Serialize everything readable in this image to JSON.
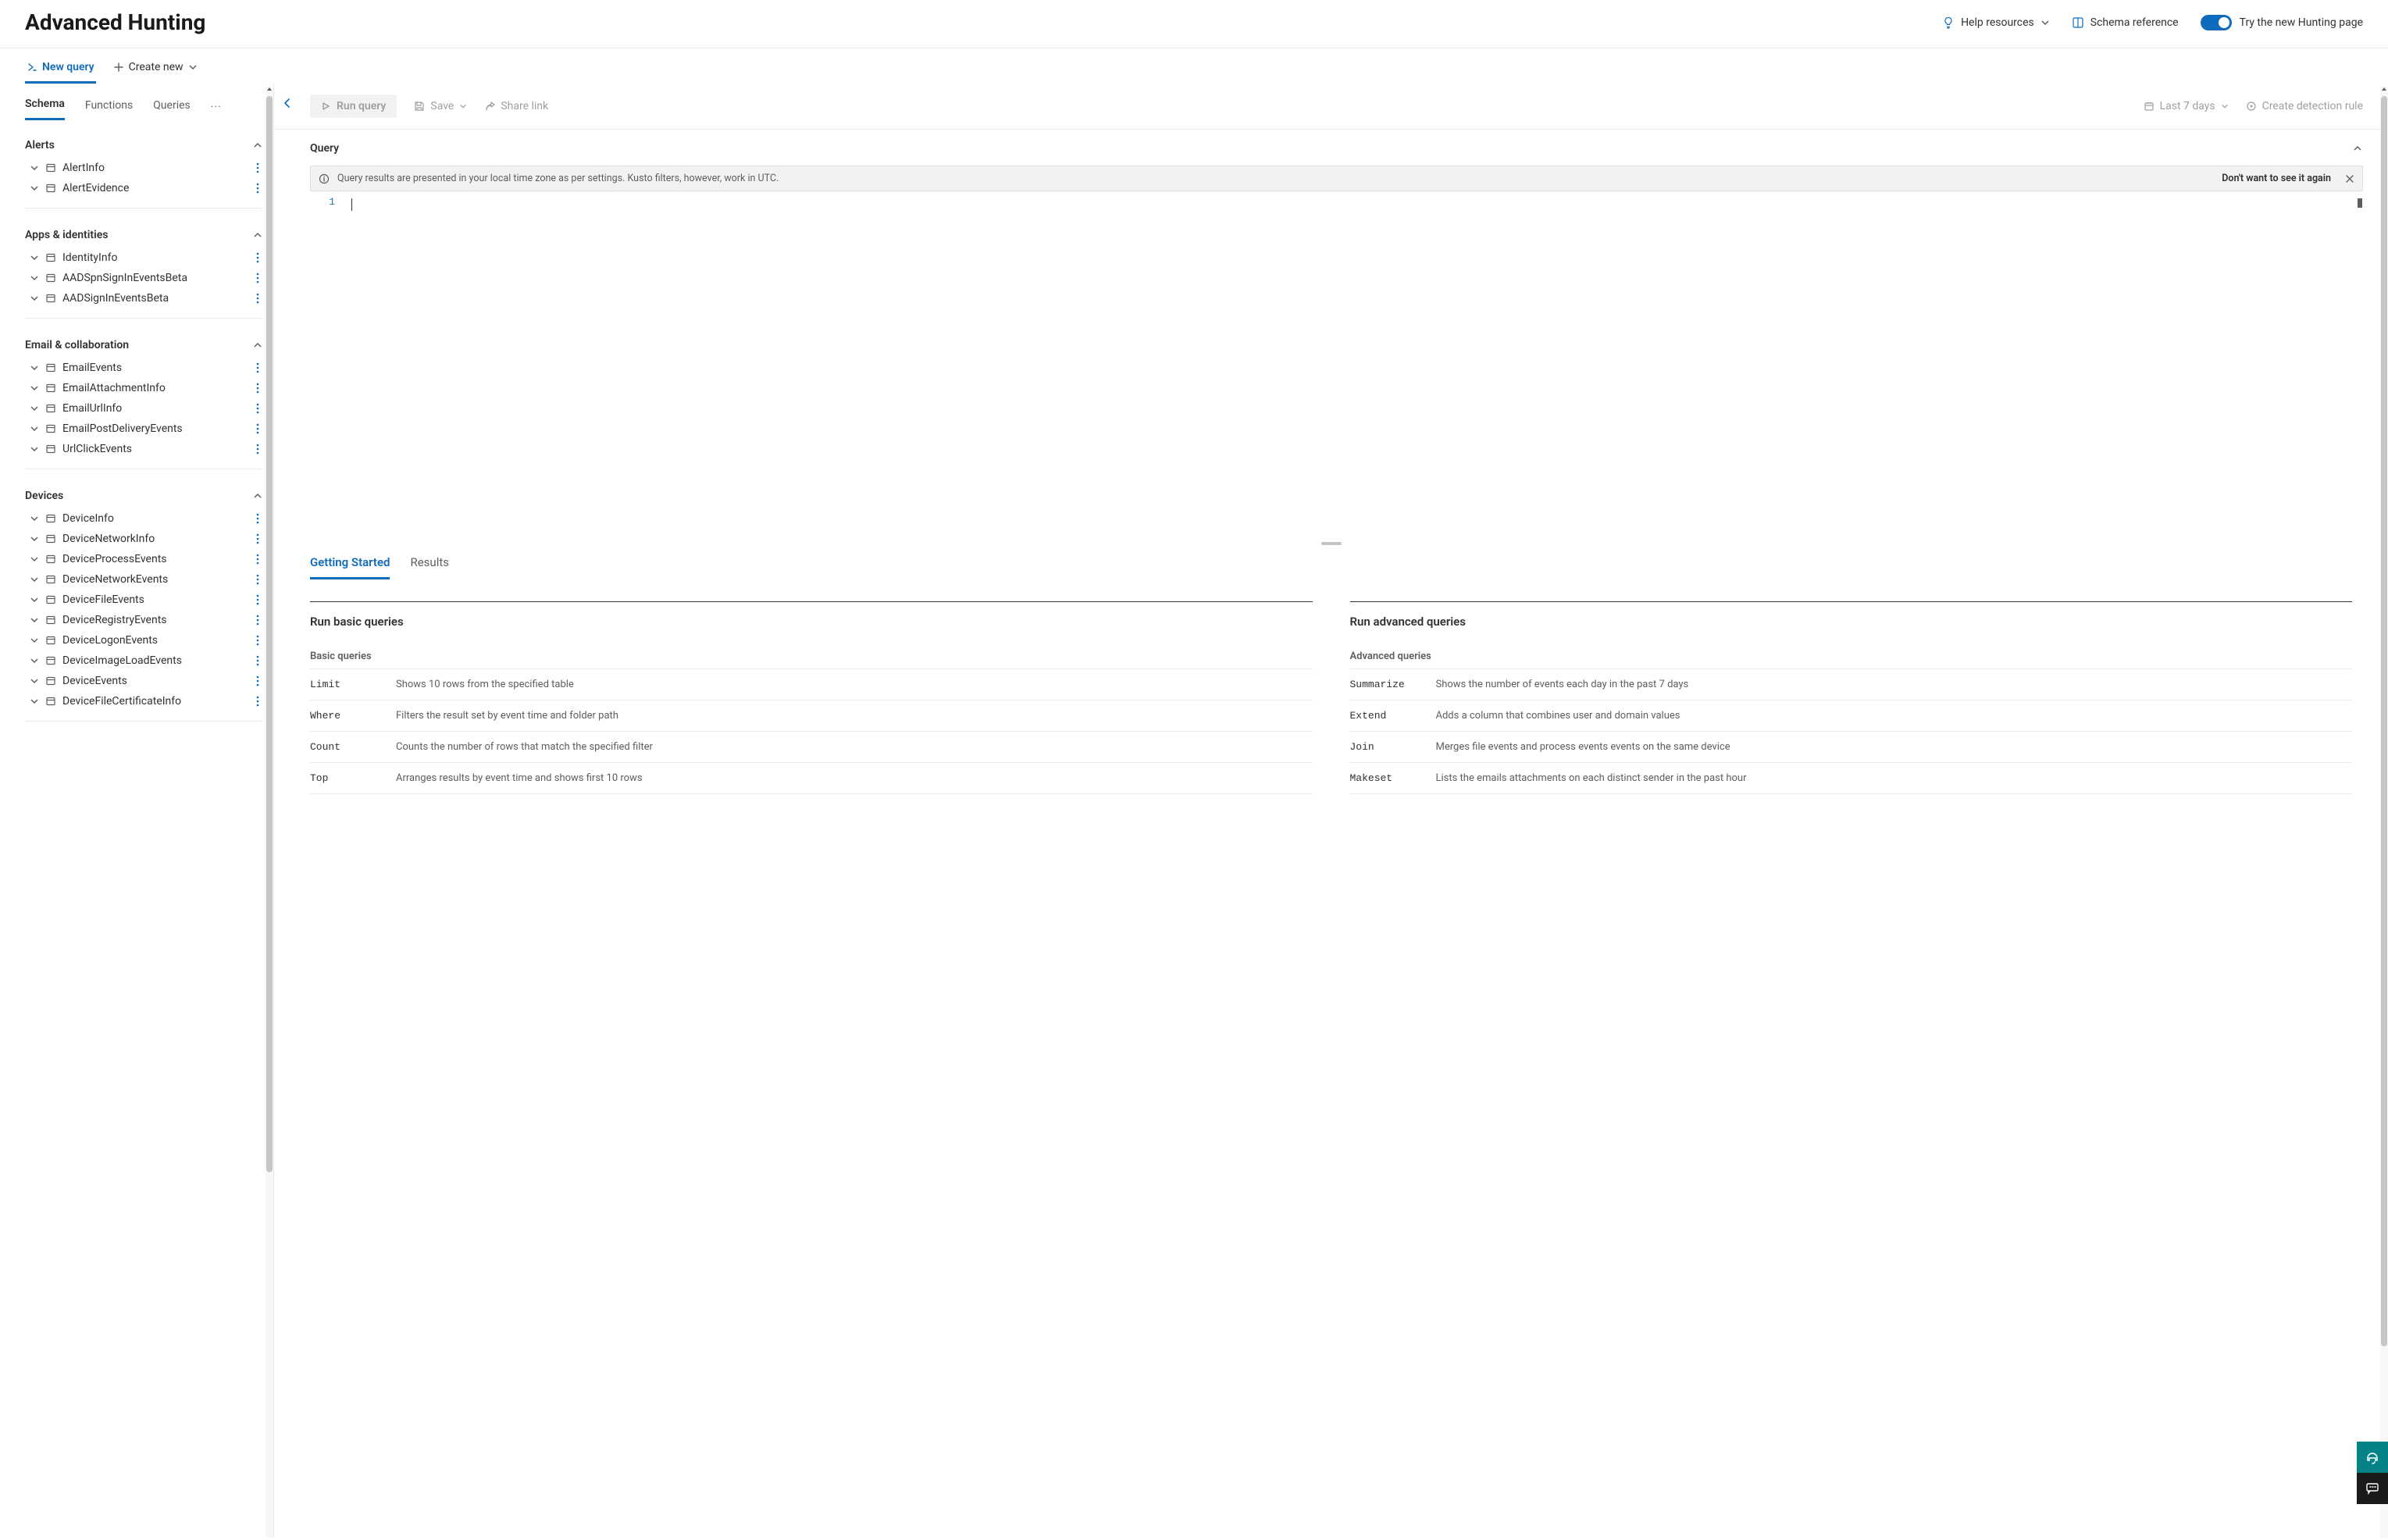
{
  "header": {
    "title": "Advanced Hunting",
    "help": "Help resources",
    "schema_ref": "Schema reference",
    "toggle_label": "Try the new Hunting page"
  },
  "tabs": {
    "new_query": "New query",
    "create_new": "Create new"
  },
  "schema_tabs": {
    "schema": "Schema",
    "functions": "Functions",
    "queries": "Queries",
    "more": "···"
  },
  "schema": [
    {
      "name": "Alerts",
      "items": [
        "AlertInfo",
        "AlertEvidence"
      ]
    },
    {
      "name": "Apps & identities",
      "items": [
        "IdentityInfo",
        "AADSpnSignInEventsBeta",
        "AADSignInEventsBeta"
      ]
    },
    {
      "name": "Email & collaboration",
      "items": [
        "EmailEvents",
        "EmailAttachmentInfo",
        "EmailUrlInfo",
        "EmailPostDeliveryEvents",
        "UrlClickEvents"
      ]
    },
    {
      "name": "Devices",
      "items": [
        "DeviceInfo",
        "DeviceNetworkInfo",
        "DeviceProcessEvents",
        "DeviceNetworkEvents",
        "DeviceFileEvents",
        "DeviceRegistryEvents",
        "DeviceLogonEvents",
        "DeviceImageLoadEvents",
        "DeviceEvents",
        "DeviceFileCertificateInfo"
      ]
    }
  ],
  "toolbar": {
    "run": "Run query",
    "save": "Save",
    "share": "Share link",
    "timerange": "Last 7 days",
    "create_rule": "Create detection rule"
  },
  "query": {
    "heading": "Query",
    "info": "Query results are presented in your local time zone as per settings. Kusto filters, however, work in UTC.",
    "dismiss": "Don't want to see it again",
    "line1": "1"
  },
  "results_tabs": {
    "getting_started": "Getting Started",
    "results": "Results"
  },
  "basic": {
    "title": "Run basic queries",
    "sub": "Basic queries",
    "rows": [
      {
        "k": "Limit",
        "v": "Shows 10 rows from the specified table"
      },
      {
        "k": "Where",
        "v": "Filters the result set by event time and folder path"
      },
      {
        "k": "Count",
        "v": "Counts the number of rows that match the specified filter"
      },
      {
        "k": "Top",
        "v": "Arranges results by event time and shows first 10 rows"
      }
    ]
  },
  "advanced": {
    "title": "Run advanced queries",
    "sub": "Advanced queries",
    "rows": [
      {
        "k": "Summarize",
        "v": "Shows the number of events each day in the past 7 days"
      },
      {
        "k": "Extend",
        "v": "Adds a column that combines user and domain values"
      },
      {
        "k": "Join",
        "v": "Merges file events and process events events on the same device"
      },
      {
        "k": "Makeset",
        "v": "Lists the emails attachments on each distinct sender in the past hour"
      }
    ]
  }
}
